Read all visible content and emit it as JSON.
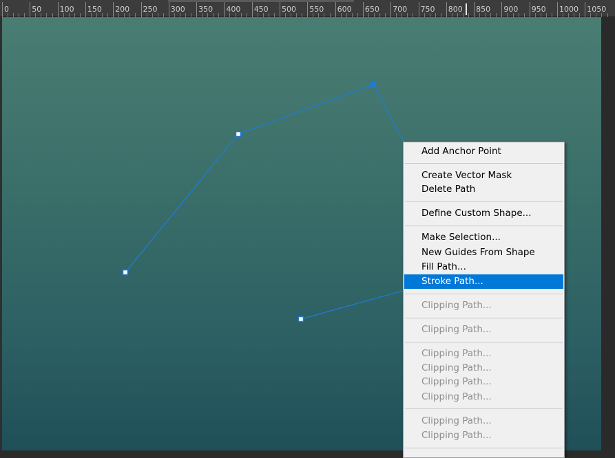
{
  "ruler": {
    "labels": [
      "0",
      "50",
      "100",
      "150",
      "200",
      "250",
      "300",
      "350",
      "400",
      "450",
      "500",
      "550",
      "600",
      "650",
      "700",
      "750",
      "800",
      "850",
      "900",
      "950",
      "1000",
      "1050"
    ]
  },
  "canvas": {
    "gradient_top": "#4a7d72",
    "gradient_bottom": "#1f4f58",
    "path_color": "#1f7bd6"
  },
  "context_menu": {
    "highlight_color": "#0078d7",
    "items": [
      {
        "label": "Add Anchor Point",
        "enabled": true,
        "highlighted": false
      },
      {
        "label": "Create Vector Mask",
        "enabled": true,
        "highlighted": false
      },
      {
        "label": "Delete Path",
        "enabled": true,
        "highlighted": false
      },
      {
        "label": "Define Custom Shape...",
        "enabled": true,
        "highlighted": false
      },
      {
        "label": "Make Selection...",
        "enabled": true,
        "highlighted": false
      },
      {
        "label": "New Guides From Shape",
        "enabled": true,
        "highlighted": false
      },
      {
        "label": "Fill Path...",
        "enabled": true,
        "highlighted": false
      },
      {
        "label": "Stroke Path...",
        "enabled": true,
        "highlighted": true
      },
      {
        "label": "Clipping Path...",
        "enabled": false,
        "highlighted": false
      },
      {
        "label": "Clipping Path...",
        "enabled": false,
        "highlighted": false
      },
      {
        "label": "Clipping Path...",
        "enabled": false,
        "highlighted": false
      },
      {
        "label": "Clipping Path...",
        "enabled": false,
        "highlighted": false
      },
      {
        "label": "Clipping Path...",
        "enabled": false,
        "highlighted": false
      },
      {
        "label": "Clipping Path...",
        "enabled": false,
        "highlighted": false
      },
      {
        "label": "Clipping Path...",
        "enabled": false,
        "highlighted": false
      },
      {
        "label": "Clipping Path...",
        "enabled": false,
        "highlighted": false
      }
    ]
  }
}
